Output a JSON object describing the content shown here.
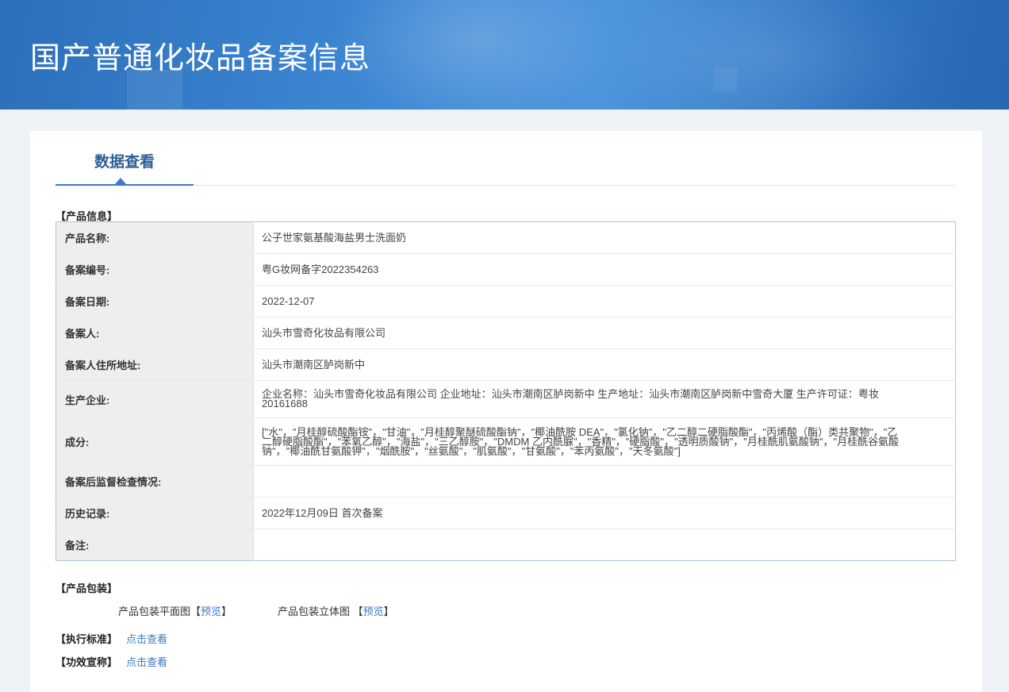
{
  "header": {
    "title": "国产普通化妆品备案信息"
  },
  "tab": {
    "label": "数据查看"
  },
  "sections": {
    "product_info": "【产品信息】",
    "packaging": "【产品包装】",
    "standard": "【执行标准】",
    "efficacy": "【功效宣称】"
  },
  "product_table": [
    {
      "label": "产品名称:",
      "value": "公子世家氨基酸海盐男士洗面奶"
    },
    {
      "label": "备案编号:",
      "value": "粤G妆网备字2022354263"
    },
    {
      "label": "备案日期:",
      "value": "2022-12-07"
    },
    {
      "label": "备案人:",
      "value": "汕头市雪奇化妆品有限公司"
    },
    {
      "label": "备案人住所地址:",
      "value": "汕头市潮南区胪岗新中"
    },
    {
      "label": "生产企业:",
      "value": "企业名称：汕头市雪奇化妆品有限公司 企业地址：汕头市潮南区胪岗新中 生产地址：汕头市潮南区胪岗新中雪奇大厦 生产许可证：粤妆20161688"
    },
    {
      "label": "成分:",
      "value": "[\"水\"，\"月桂醇硫酸酯铵\"，\"甘油\"，\"月桂醇聚醚硫酸酯钠\"，\"椰油酰胺 DEA\"，\"氯化钠\"，\"乙二醇二硬脂酸酯\"，\"丙烯酸（酯）类共聚物\"，\"乙二醇硬脂酸酯\"，\"苯氧乙醇\"，\"海盐\"，\"三乙醇胺\"，\"DMDM 乙内酰脲\"，\"香精\"，\"硬脂酸\"，\"透明质酸钠\"，\"月桂酰肌氨酸钠\"，\"月桂酰谷氨酸钠\"，\"椰油酰甘氨酸钾\"，\"烟酰胺\"，\"丝氨酸\"，\"肌氨酸\"，\"甘氨酸\"，\"苯丙氨酸\"，\"天冬氨酸\"]"
    },
    {
      "label": "备案后监督检查情况:",
      "value": ""
    },
    {
      "label": "历史记录:",
      "value": "2022年12月09日 首次备案"
    },
    {
      "label": "备注:",
      "value": ""
    }
  ],
  "packaging": {
    "flat_label": "产品包装平面图",
    "stereo_label": "产品包装立体图",
    "preview_link": "预览",
    "bracket_open": "【",
    "bracket_close": "】"
  },
  "links": {
    "view": "点击查看"
  },
  "colors": {
    "banner": "#3a80cc",
    "link": "#3a7bc8",
    "tab_text": "#2b5f94",
    "key_bg": "#eeeeee"
  }
}
